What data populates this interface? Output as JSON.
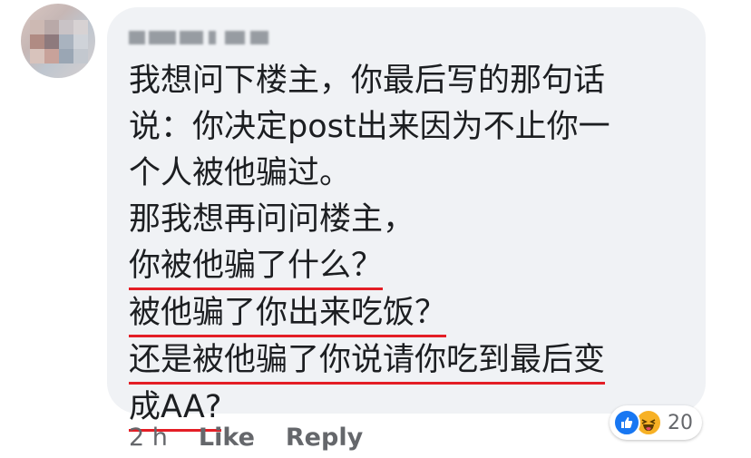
{
  "comment": {
    "lines": [
      "我想问下楼主，你最后写的那句话",
      "说：你决定post出来因为不止你一",
      "个人被他骗过。",
      "那我想再问问楼主，",
      "你被他骗了什么？",
      "被他骗了你出来吃饭？",
      "还是被他骗了你说请你吃到最后变",
      "成AA?"
    ]
  },
  "footer": {
    "time": "2 h",
    "like_label": "Like",
    "reply_label": "Reply"
  },
  "reactions": {
    "icons": [
      "like-icon",
      "haha-icon"
    ],
    "count": "20"
  },
  "colors": {
    "bubble": "#f0f2f5",
    "text": "#1c1e21",
    "meta": "#65676b",
    "underline": "#e41e26",
    "like_blue": "#1877f2",
    "haha_yellow": "#f7b125"
  }
}
